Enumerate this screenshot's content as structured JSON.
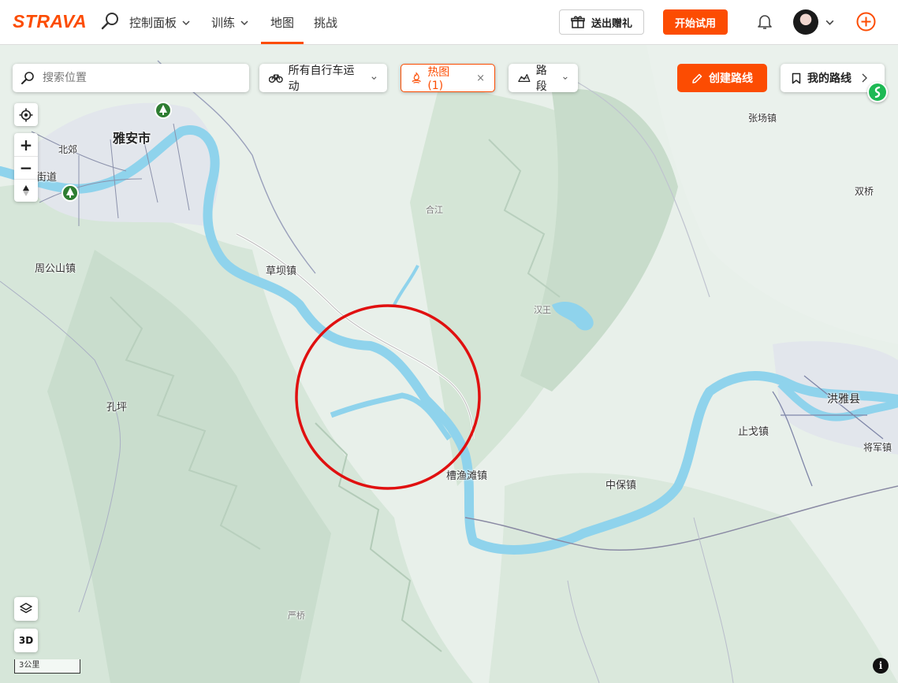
{
  "nav": {
    "logo": "STRAVA",
    "links": [
      {
        "label": "控制面板"
      },
      {
        "label": "训练"
      },
      {
        "label": "地图"
      },
      {
        "label": "挑战"
      }
    ],
    "gift_label": "送出赠礼",
    "trial_label": "开始试用",
    "accent_color": "#fc4c02"
  },
  "map_controls": {
    "search_placeholder": "搜索位置",
    "sport_filter": "所有自行车运动",
    "heatmap_label": "热图 (1)",
    "heatmap_close": "×",
    "segments_label": "路段",
    "create_route_label": "创建路线",
    "my_routes_label": "我的路线",
    "zoom_in": "+",
    "zoom_out": "−",
    "btn_3d": "3D",
    "scale_label": "3公里",
    "info": "i"
  },
  "places": {
    "yaan": "雅安市",
    "beijiao": "北郊",
    "jiedao": "街道",
    "zhougongshan": "周公山镇",
    "caobazhen": "草坝镇",
    "hejiang": "合江",
    "hanwang": "汉王",
    "kongping": "孔坪",
    "caoyutan": "槽渔滩镇",
    "zhongbao": "中保镇",
    "zhigezhen": "止戈镇",
    "hongya": "洪雅县",
    "jiangjun": "将军镇",
    "zhangchang": "张场镇",
    "shuangqiao": "双桥",
    "yanqiao": "严桥"
  },
  "icons": {
    "search": "search-icon",
    "bike": "bike-icon",
    "heatmap": "heatmap-icon",
    "segments": "segment-icon",
    "pencil": "pencil-icon",
    "bookmark": "bookmark-icon",
    "locate": "locate-icon",
    "compass": "compass-icon",
    "layers": "layers-icon",
    "park": "park-icon"
  },
  "colors": {
    "river": "#8fd3ec",
    "terrain": "#e7efe9",
    "highlight_circle": "#e01010"
  }
}
